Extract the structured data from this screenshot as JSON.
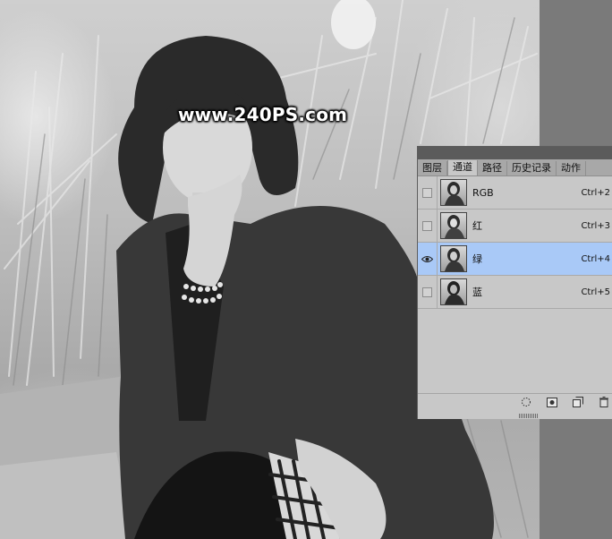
{
  "watermark": "www.240PS.com",
  "panel": {
    "tabs": [
      "图层",
      "通道",
      "路径",
      "历史记录",
      "动作"
    ],
    "active_tab": "通道",
    "channels": [
      {
        "name": "RGB",
        "shortcut": "Ctrl+2",
        "visible": false,
        "selected": false
      },
      {
        "name": "红",
        "shortcut": "Ctrl+3",
        "visible": false,
        "selected": false
      },
      {
        "name": "绿",
        "shortcut": "Ctrl+4",
        "visible": true,
        "selected": true
      },
      {
        "name": "蓝",
        "shortcut": "Ctrl+5",
        "visible": false,
        "selected": false
      }
    ],
    "footer_icons": [
      "load-selection-icon",
      "save-selection-icon",
      "new-channel-icon",
      "delete-channel-icon"
    ]
  },
  "colors": {
    "selected_row": "#a9c9f7",
    "panel_bg": "#c8c8c8",
    "tab_bar": "#a8a8a8"
  }
}
